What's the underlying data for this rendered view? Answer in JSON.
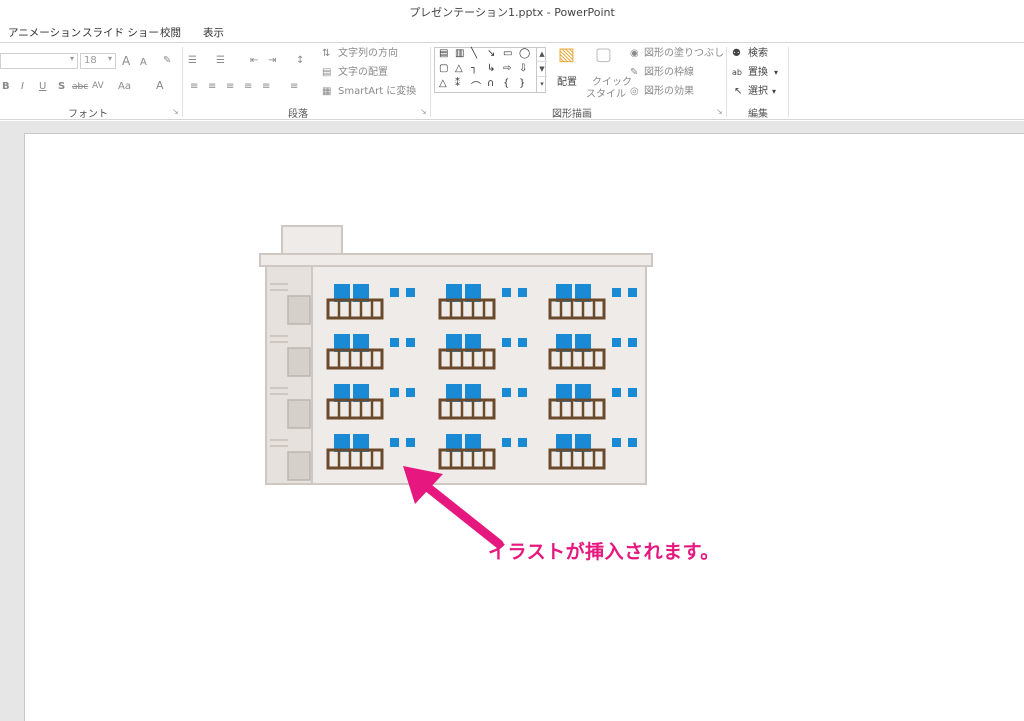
{
  "window": {
    "title": "プレゼンテーション1.pptx - PowerPoint"
  },
  "tabs": [
    "アニメーション",
    "スライド ショー",
    "校閲",
    "表示"
  ],
  "ribbon": {
    "font": {
      "label": "フォント",
      "size": "18",
      "grow": "A",
      "shrink": "A",
      "bold": "B",
      "italic": "I",
      "underline": "U",
      "shadow": "S",
      "strike": "abc",
      "spacing": "AV",
      "case": "Aa",
      "color": "A"
    },
    "paragraph": {
      "label": "段落",
      "text_direction": "文字列の方向",
      "align_text": "文字の配置",
      "smartart": "SmartArt に変換"
    },
    "drawing": {
      "label": "図形描画",
      "arrange": "配置",
      "quick_styles_1": "クイック",
      "quick_styles_2": "スタイル",
      "fill": "図形の塗りつぶし",
      "outline": "図形の枠線",
      "effects": "図形の効果"
    },
    "editing": {
      "label": "編集",
      "find": "検索",
      "replace": "置換",
      "select": "選択"
    }
  },
  "slide": {
    "callout": "イラストが挿入されます。",
    "accent_color": "#e6177f",
    "window_color": "#1a8ad4",
    "balcony_color": "#6b4a2b"
  }
}
